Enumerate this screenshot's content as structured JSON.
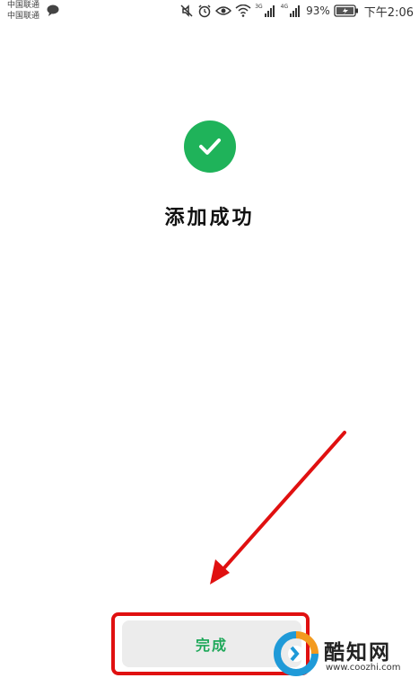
{
  "status_bar": {
    "carrier_1": "中国联通",
    "carrier_2": "中国联通",
    "net_3g": "3G",
    "net_4g": "4G",
    "battery": "93%",
    "time": "下午2:06"
  },
  "result": {
    "title": "添加成功",
    "icon": "check-circle-icon",
    "accent_color": "#1fb35a"
  },
  "done_button": {
    "label": "完成"
  },
  "annotation": {
    "color": "#e01010"
  },
  "watermark": {
    "name": "酷知网",
    "url": "www.coozhi.com"
  }
}
